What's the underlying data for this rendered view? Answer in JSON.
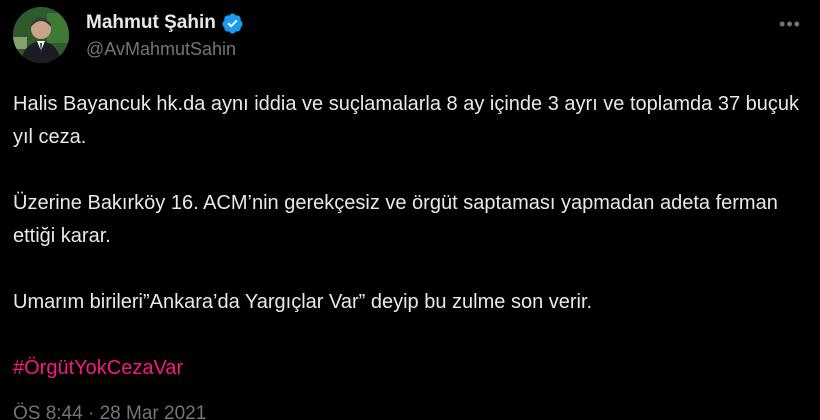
{
  "author": {
    "display_name": "Mahmut Şahin",
    "handle": "@AvMahmutSahin",
    "verified": true,
    "verified_color": "#1d9bf0"
  },
  "menu": {
    "more_icon": "more-horizontal-icon",
    "glyph": "•••"
  },
  "tweet": {
    "paragraphs": [
      "Halis Bayancuk hk.da aynı iddia ve suçlamalarla 8 ay içinde 3 ayrı ve toplamda 37 buçuk yıl ceza.",
      "Üzerine Bakırköy 16. ACM’nin gerekçesiz ve örgüt saptaması yapmadan adeta ferman ettiği karar.",
      "Umarım birileri”Ankara’da Yargıçlar Var” deyip bu zulme son verir."
    ],
    "hashtag": "#ÖrgütYokCezaVar",
    "hashtag_color": "#f91880"
  },
  "meta": {
    "timestamp": "ÖS 8:44 · 28 Mar 2021"
  },
  "colors": {
    "background": "#000000",
    "text": "#e7e9ea",
    "secondary": "#71767b"
  }
}
